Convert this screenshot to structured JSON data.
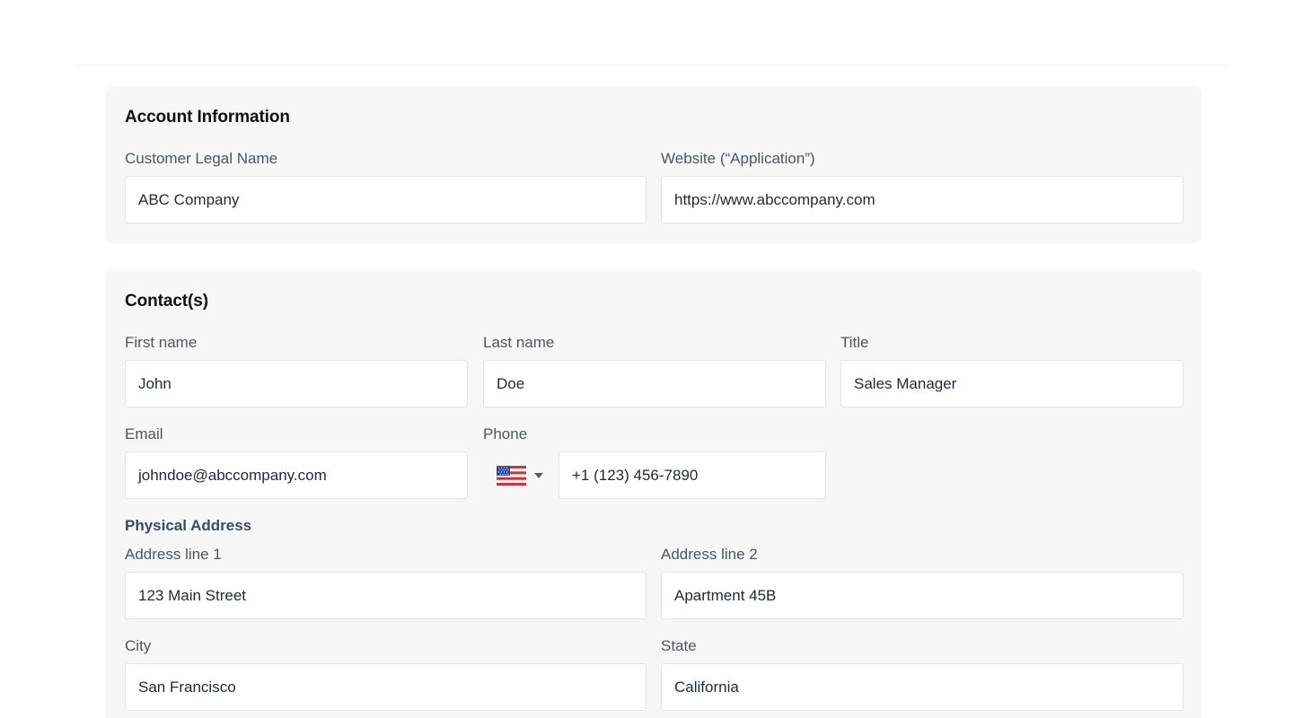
{
  "account": {
    "title": "Account Information",
    "legal_name_label": "Customer Legal Name",
    "legal_name_value": "ABC Company",
    "website_label": "Website (“Application”)",
    "website_value": "https://www.abccompany.com"
  },
  "contacts": {
    "title": "Contact(s)",
    "first_name_label": "First name",
    "first_name_value": "John",
    "last_name_label": "Last name",
    "last_name_value": "Doe",
    "title_label": "Title",
    "title_value": "Sales Manager",
    "email_label": "Email",
    "email_value": "johndoe@abccompany.com",
    "phone_label": "Phone",
    "phone_country_icon": "us-flag-icon",
    "phone_value": "+1 (123) 456-7890",
    "address": {
      "title": "Physical Address",
      "line1_label": "Address line 1",
      "line1_value": "123 Main Street",
      "line2_label": "Address line 2",
      "line2_value": "Apartment 45B",
      "city_label": "City",
      "city_value": "San Francisco",
      "state_label": "State",
      "state_value": "California"
    }
  },
  "colors": {
    "card_bg": "#f7f7f7",
    "input_border": "#e2e4e8",
    "label": "#4b5563"
  }
}
